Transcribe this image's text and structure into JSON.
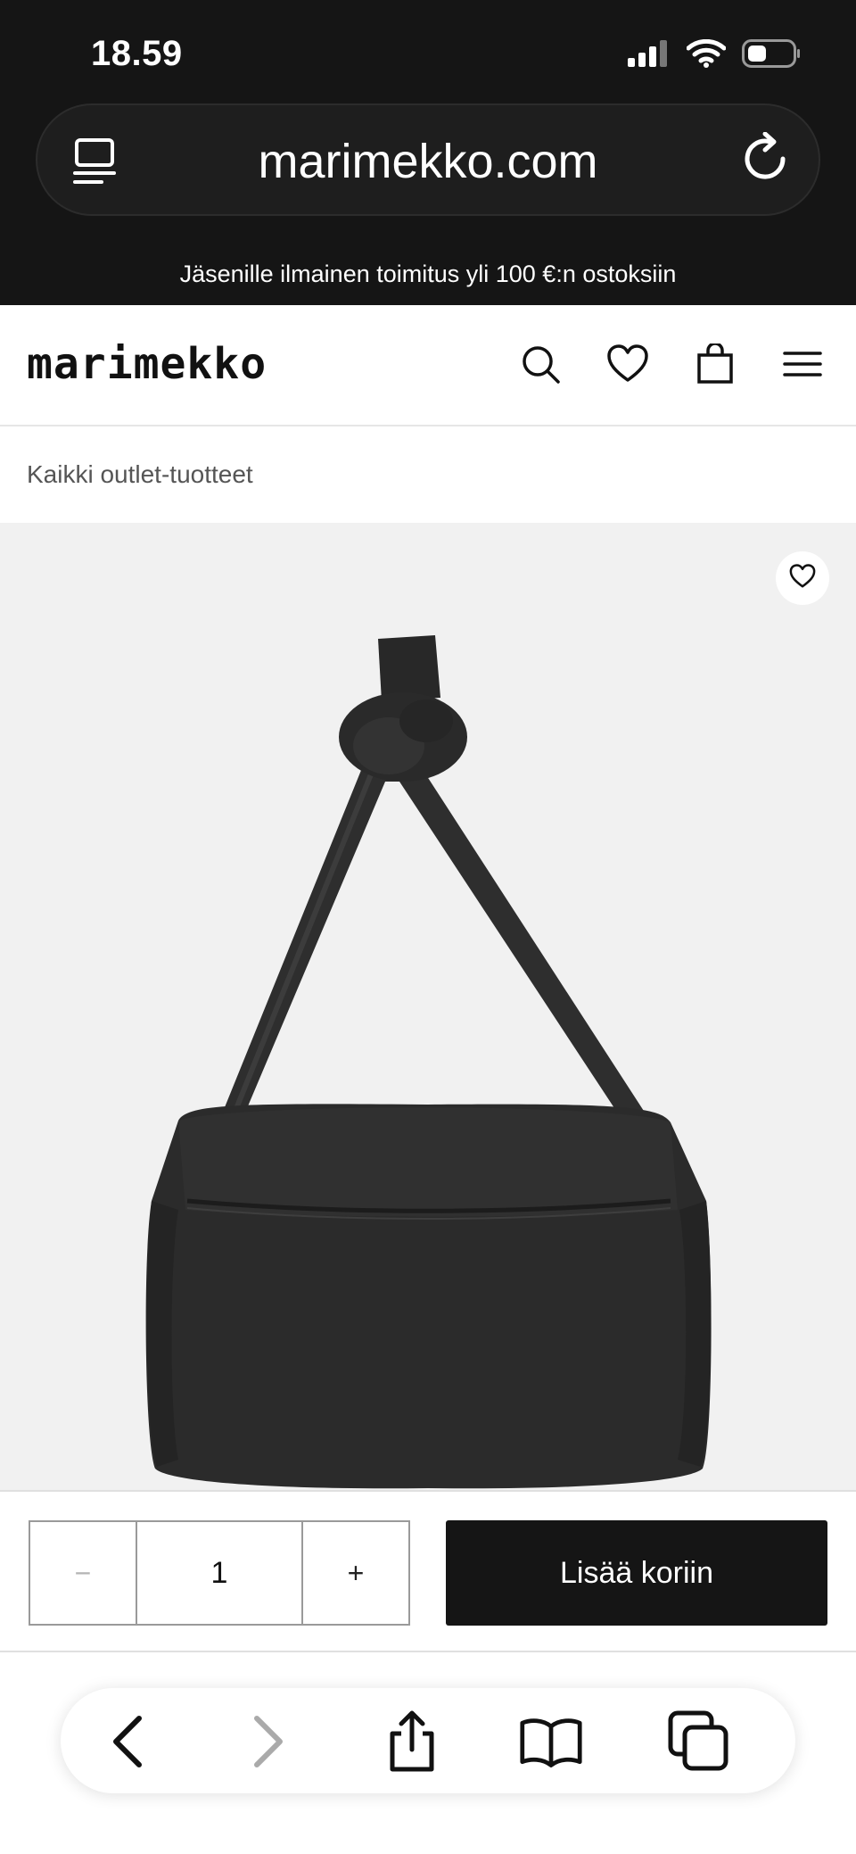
{
  "status_bar": {
    "time": "18.59"
  },
  "browser": {
    "url": "marimekko.com"
  },
  "promo_banner": {
    "text": "Jäsenille ilmainen toimitus yli 100 €:n ostoksiin"
  },
  "header": {
    "logo": "marimekko",
    "icons": [
      "search-icon",
      "heart-icon",
      "shopping-bag-icon",
      "menu-icon"
    ]
  },
  "breadcrumb": {
    "label": "Kaikki outlet-tuotteet"
  },
  "cart": {
    "minus_label": "−",
    "quantity": "1",
    "plus_label": "+",
    "add_to_cart_label": "Lisää koriin"
  },
  "toolbar": {
    "icons": [
      "back-icon",
      "forward-icon",
      "share-icon",
      "bookmarks-icon",
      "tabs-icon"
    ]
  },
  "colors": {
    "dark": "#151515",
    "image_bg": "#f1f1f1",
    "bag": "#2b2b2b"
  }
}
